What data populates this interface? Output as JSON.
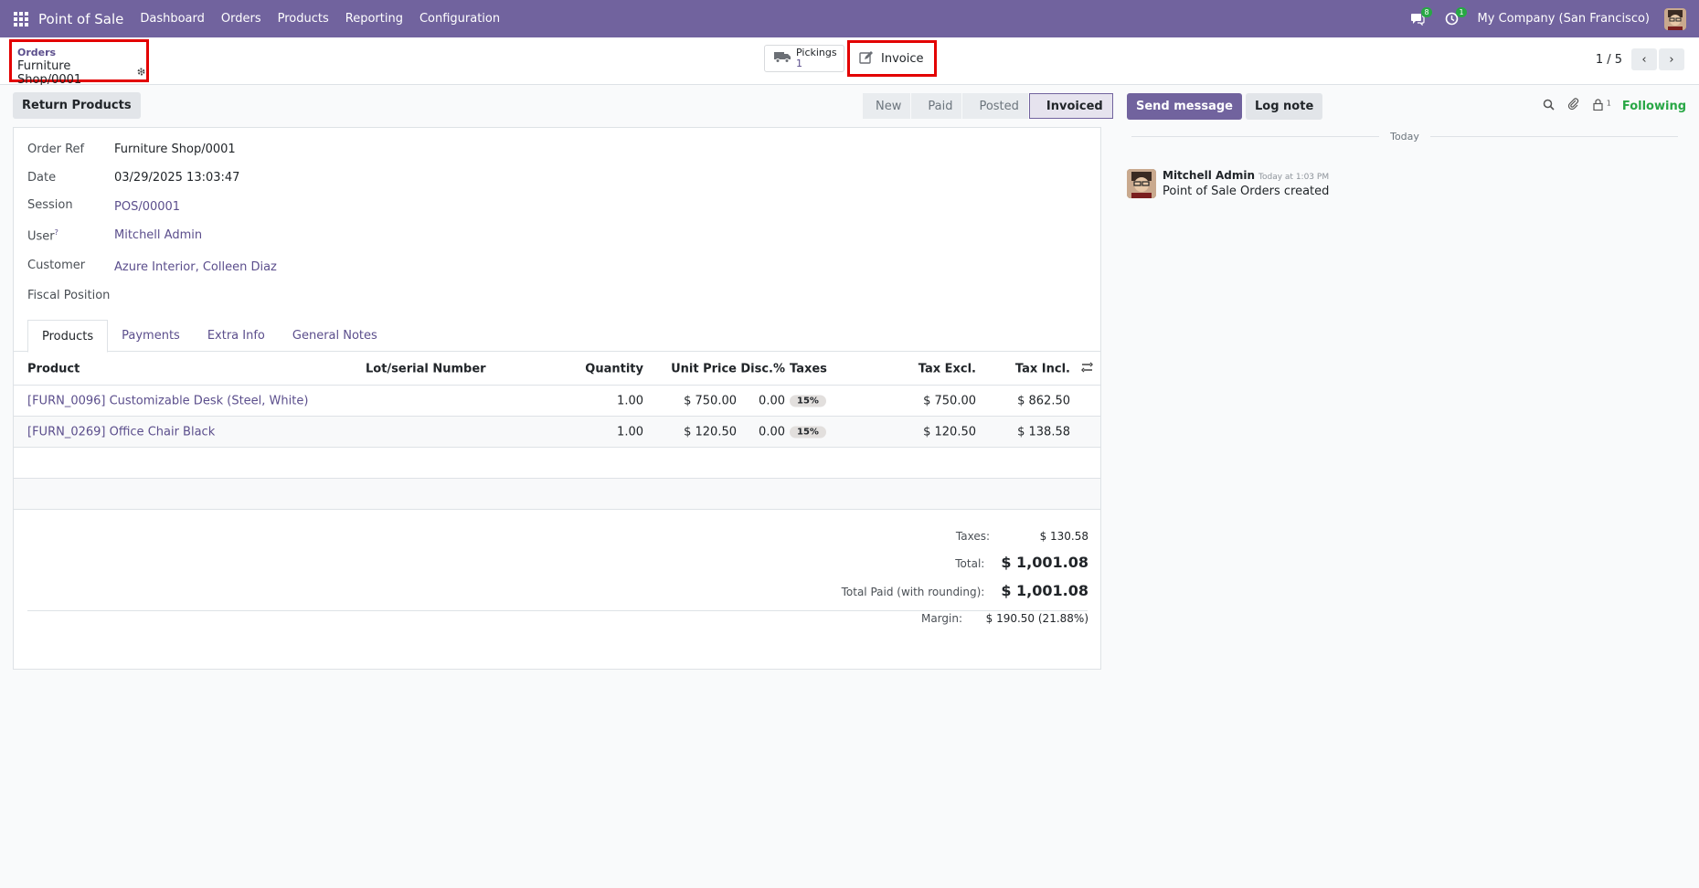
{
  "navbar": {
    "app_name": "Point of Sale",
    "menu": [
      "Dashboard",
      "Orders",
      "Products",
      "Reporting",
      "Configuration"
    ],
    "messages_badge": "8",
    "activities_badge": "1",
    "company": "My Company (San Francisco)"
  },
  "breadcrumb": {
    "parent": "Orders",
    "current": "Furniture Shop/0001"
  },
  "smart_buttons": {
    "pickings_label": "Pickings",
    "pickings_count": "1",
    "invoice_label": "Invoice"
  },
  "pager": {
    "value": "1 / 5"
  },
  "actions": {
    "return_products": "Return Products"
  },
  "statusbar": {
    "stages": [
      "New",
      "Paid",
      "Posted",
      "Invoiced"
    ],
    "active": "Invoiced"
  },
  "fields": {
    "order_ref_label": "Order Ref",
    "order_ref": "Furniture Shop/0001",
    "date_label": "Date",
    "date": "03/29/2025 13:03:47",
    "session_label": "Session",
    "session": "POS/00001",
    "user_label": "User",
    "user_help": "?",
    "user": "Mitchell Admin",
    "customer_label": "Customer",
    "customer": "Azure Interior, Colleen Diaz",
    "fiscal_position_label": "Fiscal Position",
    "fiscal_position": ""
  },
  "tabs": [
    "Products",
    "Payments",
    "Extra Info",
    "General Notes"
  ],
  "table": {
    "headers": {
      "product": "Product",
      "lot": "Lot/serial Number",
      "quantity": "Quantity",
      "unit_price": "Unit Price",
      "disc": "Disc.%",
      "taxes": "Taxes",
      "tax_excl": "Tax Excl.",
      "tax_incl": "Tax Incl."
    },
    "rows": [
      {
        "product": "[FURN_0096] Customizable Desk (Steel, White)",
        "lot": "",
        "quantity": "1.00",
        "unit_price": "$ 750.00",
        "disc": "0.00",
        "taxes": "15%",
        "tax_excl": "$ 750.00",
        "tax_incl": "$ 862.50"
      },
      {
        "product": "[FURN_0269] Office Chair Black",
        "lot": "",
        "quantity": "1.00",
        "unit_price": "$ 120.50",
        "disc": "0.00",
        "taxes": "15%",
        "tax_excl": "$ 120.50",
        "tax_incl": "$ 138.58"
      }
    ]
  },
  "totals": {
    "taxes_label": "Taxes:",
    "taxes": "$ 130.58",
    "total_label": "Total:",
    "total": "$ 1,001.08",
    "paid_label": "Total Paid (with rounding):",
    "paid": "$ 1,001.08",
    "margin_label": "Margin:",
    "margin": "$ 190.50 (21.88%)"
  },
  "chatter": {
    "send_message": "Send message",
    "log_note": "Log note",
    "followers_count": "1",
    "following": "Following",
    "date_separator": "Today",
    "message": {
      "author": "Mitchell Admin",
      "time": "Today at 1:03 PM",
      "text": "Point of Sale Orders created"
    }
  },
  "colors": {
    "navbar": "#71639e",
    "link": "#5b4e8c",
    "highlight_border": "#e30000",
    "following": "#28a745"
  }
}
